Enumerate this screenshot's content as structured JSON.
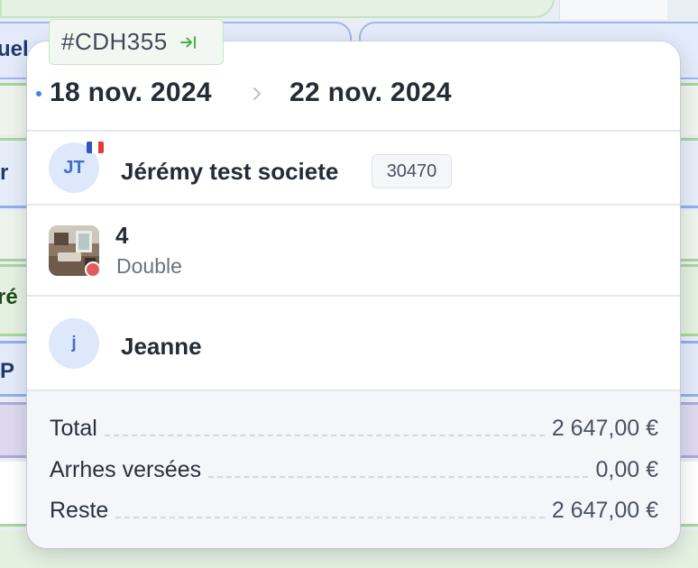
{
  "background": {
    "fragments": [
      "uel",
      "r",
      "ré",
      "P"
    ]
  },
  "booking": {
    "reference": "#CDH355",
    "open_icon": "arrow-to-right-icon",
    "check_in": "18 nov. 2024",
    "check_out": "22 nov. 2024"
  },
  "client": {
    "initials": "JT",
    "name": "Jérémy test societe",
    "postal_code": "30470",
    "flag": "france-flag-icon"
  },
  "room": {
    "number": "4",
    "type": "Double",
    "status_color": "#e05d5d"
  },
  "staff": {
    "initial": "j",
    "name": "Jeanne"
  },
  "totals": [
    {
      "label": "Total",
      "value": "2 647,00 €"
    },
    {
      "label": "Arrhes versées",
      "value": "0,00 €"
    },
    {
      "label": "Reste",
      "value": "2 647,00 €"
    }
  ],
  "colors": {
    "accent_blue": "#3b82f6",
    "chip_green": "#4caf50"
  }
}
